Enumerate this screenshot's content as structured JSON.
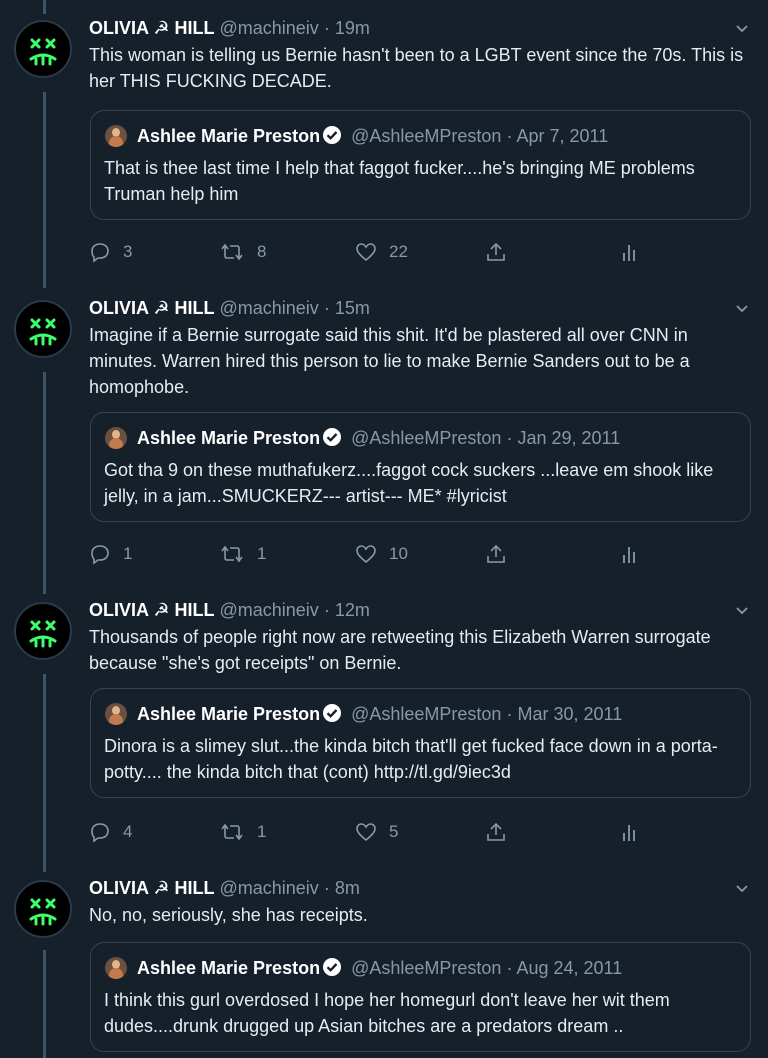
{
  "tweets": [
    {
      "name": "OLIVIA ☭ HILL",
      "handle": "@machineiv",
      "sep": "·",
      "time": "19m",
      "text": "This woman is telling us Bernie hasn't been to a LGBT event since the 70s. This is her THIS FUCKING DECADE.",
      "quote": {
        "name": "Ashlee Marie Preston",
        "handle": "@AshleeMPreston",
        "sep": "·",
        "date": "Apr 7, 2011",
        "text": "That is thee last time I help that faggot fucker....he's bringing ME problems Truman help him"
      },
      "replies": "3",
      "retweets": "8",
      "likes": "22"
    },
    {
      "name": "OLIVIA ☭ HILL",
      "handle": "@machineiv",
      "sep": "·",
      "time": "15m",
      "text": "Imagine if a Bernie surrogate said this shit. It'd be plastered all over CNN in minutes. Warren hired this person to lie to make Bernie Sanders out to be a homophobe.",
      "quote": {
        "name": "Ashlee Marie Preston",
        "handle": "@AshleeMPreston",
        "sep": "·",
        "date": "Jan 29, 2011",
        "text": "Got tha 9 on these muthafukerz....faggot cock suckers ...leave em shook like jelly, in a jam...SMUCKERZ--- artist--- ME* #lyricist"
      },
      "replies": "1",
      "retweets": "1",
      "likes": "10"
    },
    {
      "name": "OLIVIA ☭ HILL",
      "handle": "@machineiv",
      "sep": "·",
      "time": "12m",
      "text": "Thousands of people right now are retweeting this Elizabeth Warren surrogate because \"she's got receipts\" on Bernie.",
      "quote": {
        "name": "Ashlee Marie Preston",
        "handle": "@AshleeMPreston",
        "sep": "·",
        "date": "Mar 30, 2011",
        "text": "Dinora is a slimey slut...the kinda bitch that'll get fucked face down in a porta-potty.... the kinda bitch that (cont) http://tl.gd/9iec3d"
      },
      "replies": "4",
      "retweets": "1",
      "likes": "5"
    },
    {
      "name": "OLIVIA ☭ HILL",
      "handle": "@machineiv",
      "sep": "·",
      "time": "8m",
      "text": "No, no, seriously, she has receipts.",
      "quote": {
        "name": "Ashlee Marie Preston",
        "handle": "@AshleeMPreston",
        "sep": "·",
        "date": "Aug 24, 2011",
        "text": "I think this gurl overdosed I hope her homegurl don't leave her wit them dudes....drunk drugged up Asian bitches are a predators dream .."
      },
      "replies": "",
      "retweets": "",
      "likes": ""
    }
  ],
  "icons": {
    "avatar": "xx-sad-face-icon",
    "verified": "verified-badge-icon",
    "reply": "reply-icon",
    "retweet": "retweet-icon",
    "like": "heart-icon",
    "share": "share-icon",
    "analytics": "analytics-icon",
    "more": "chevron-down-icon"
  },
  "colors": {
    "background": "#15202b",
    "avatar_accent": "#3dff6a",
    "verified": "#1da1f2",
    "muted": "#8899a6",
    "border": "#38444d"
  }
}
